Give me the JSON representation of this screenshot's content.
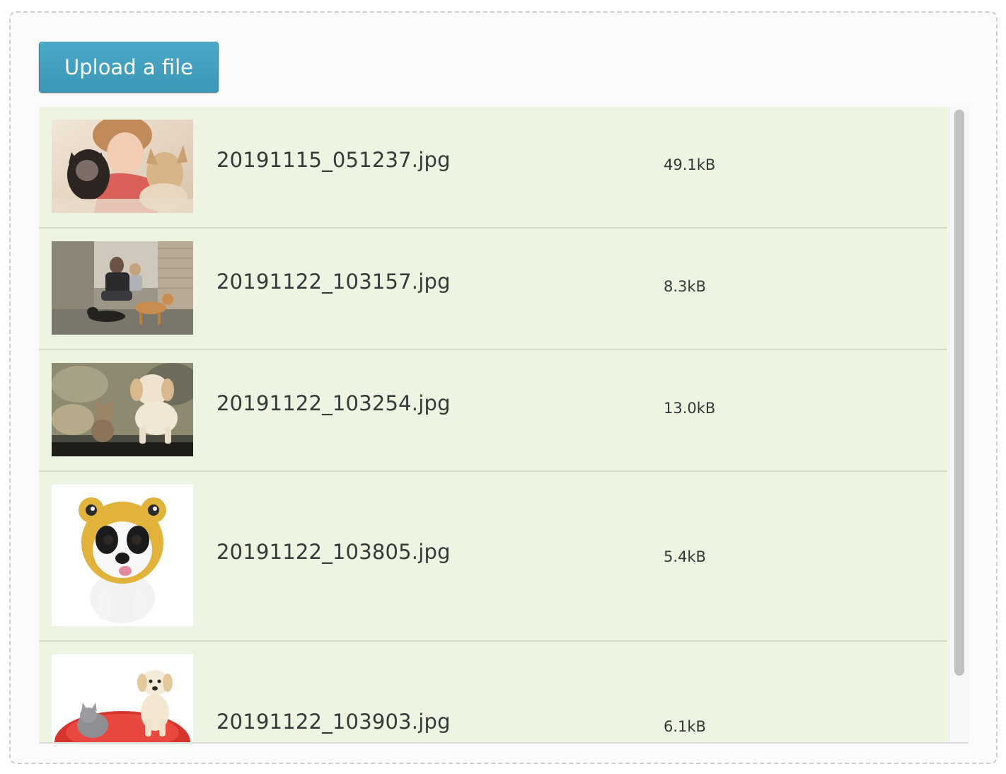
{
  "uploader": {
    "button_label": "Upload a file"
  },
  "files": [
    {
      "name": "20191115_051237.jpg",
      "size": "49.1kB",
      "thumbnail": "girl-with-cat-and-dog-photo"
    },
    {
      "name": "20191122_103157.jpg",
      "size": "8.3kB",
      "thumbnail": "man-sitting-with-dogs-photo"
    },
    {
      "name": "20191122_103254.jpg",
      "size": "13.0kB",
      "thumbnail": "kitten-and-puppy-photo"
    },
    {
      "name": "20191122_103805.jpg",
      "size": "5.4kB",
      "thumbnail": "dog-in-knitted-hat-photo"
    },
    {
      "name": "20191122_103903.jpg",
      "size": "6.1kB",
      "thumbnail": "cat-and-puppy-on-cushion-photo"
    }
  ],
  "colors": {
    "button": "#3d97b6",
    "row_background": "#edf5e2",
    "scrollbar_thumb": "#c1c1c1"
  }
}
